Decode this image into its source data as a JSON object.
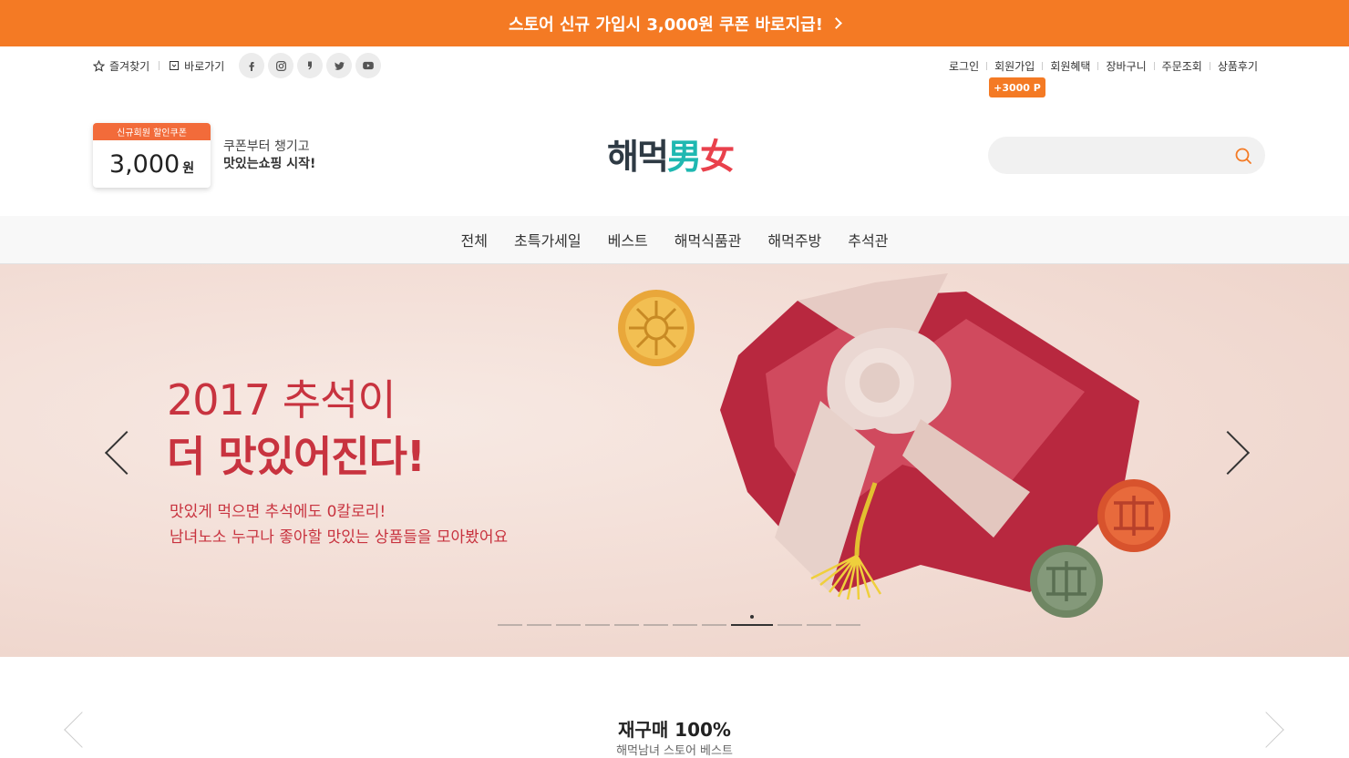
{
  "promo": {
    "text": "스토어 신규 가입시 3,000원 쿠폰 바로지급!"
  },
  "util_left": {
    "bookmark": "즐겨찾기",
    "shortcut": "바로가기"
  },
  "social": [
    "facebook-icon",
    "instagram-icon",
    "kakao-story-icon",
    "twitter-icon",
    "youtube-icon"
  ],
  "util_right": {
    "items": [
      "로그인",
      "회원가입",
      "회원혜택",
      "장바구니",
      "주문조회",
      "상품후기"
    ],
    "points": "+3000 P"
  },
  "coupon": {
    "label": "신규회원 할인쿠폰",
    "amount": "3,000",
    "unit": "원",
    "line1": "쿠폰부터 챙기고",
    "line2": "맛있는쇼핑 시작!"
  },
  "logo": {
    "part1": "해먹",
    "part2": "男",
    "part3": "女"
  },
  "search": {
    "placeholder": ""
  },
  "nav": [
    "전체",
    "초특가세일",
    "베스트",
    "해먹식품관",
    "해먹주방",
    "추석관"
  ],
  "hero": {
    "title1": "2017 추석이",
    "title2": "더 맛있어진다!",
    "sub1": "맛있게 먹으면 추석에도 0칼로리!",
    "sub2": "남녀노소 누구나 좋아할 맛있는 상품들을 모아봤어요",
    "slide_count": 12,
    "active_slide": 9,
    "colors": {
      "accent": "#f47a24",
      "hero_text": "#c8333f"
    }
  },
  "section": {
    "title": "재구매 100%",
    "subtitle": "해먹남녀 스토어 베스트"
  }
}
